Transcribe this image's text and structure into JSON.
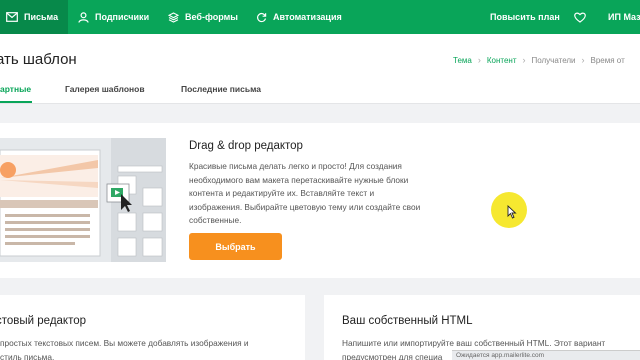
{
  "nav": {
    "mail": "Письма",
    "subscribers": "Подписчики",
    "forms": "Веб-формы",
    "automation": "Автоматизация",
    "upgrade": "Повысить план",
    "user": "ИП Маз"
  },
  "header": {
    "title": "ать шаблон",
    "breadcrumb": [
      "Тема",
      "Контент",
      "Получатели",
      "Время от"
    ],
    "tabs": [
      "артные",
      "Галерея шаблонов",
      "Последние письма"
    ]
  },
  "main_card": {
    "title": "Drag & drop редактор",
    "description": "Красивые письма делать легко и просто! Для создания необходимого вам макета перетаскивайте нужные блоки контента и редактируйте их. Вставляйте текст и изображения. Выбирайте цветовую тему или создайте свои собственные.",
    "button": "Выбрать"
  },
  "card_text": {
    "title": "стовый редактор",
    "line1": "простых текстовых писем. Вы можете добавлять изображения и",
    "line2": "стиль письма."
  },
  "card_html": {
    "title": "Ваш собственный HTML",
    "line1": "Напишите или импортируйте ваш собственный HTML. Этот вариант",
    "line2": "предусмотрен для специа"
  },
  "statusbar": "Ожидается app.mailerlite.com",
  "colors": {
    "brand_green": "#09a559",
    "button_orange": "#f7901e",
    "highlight": "#f5e51a"
  }
}
